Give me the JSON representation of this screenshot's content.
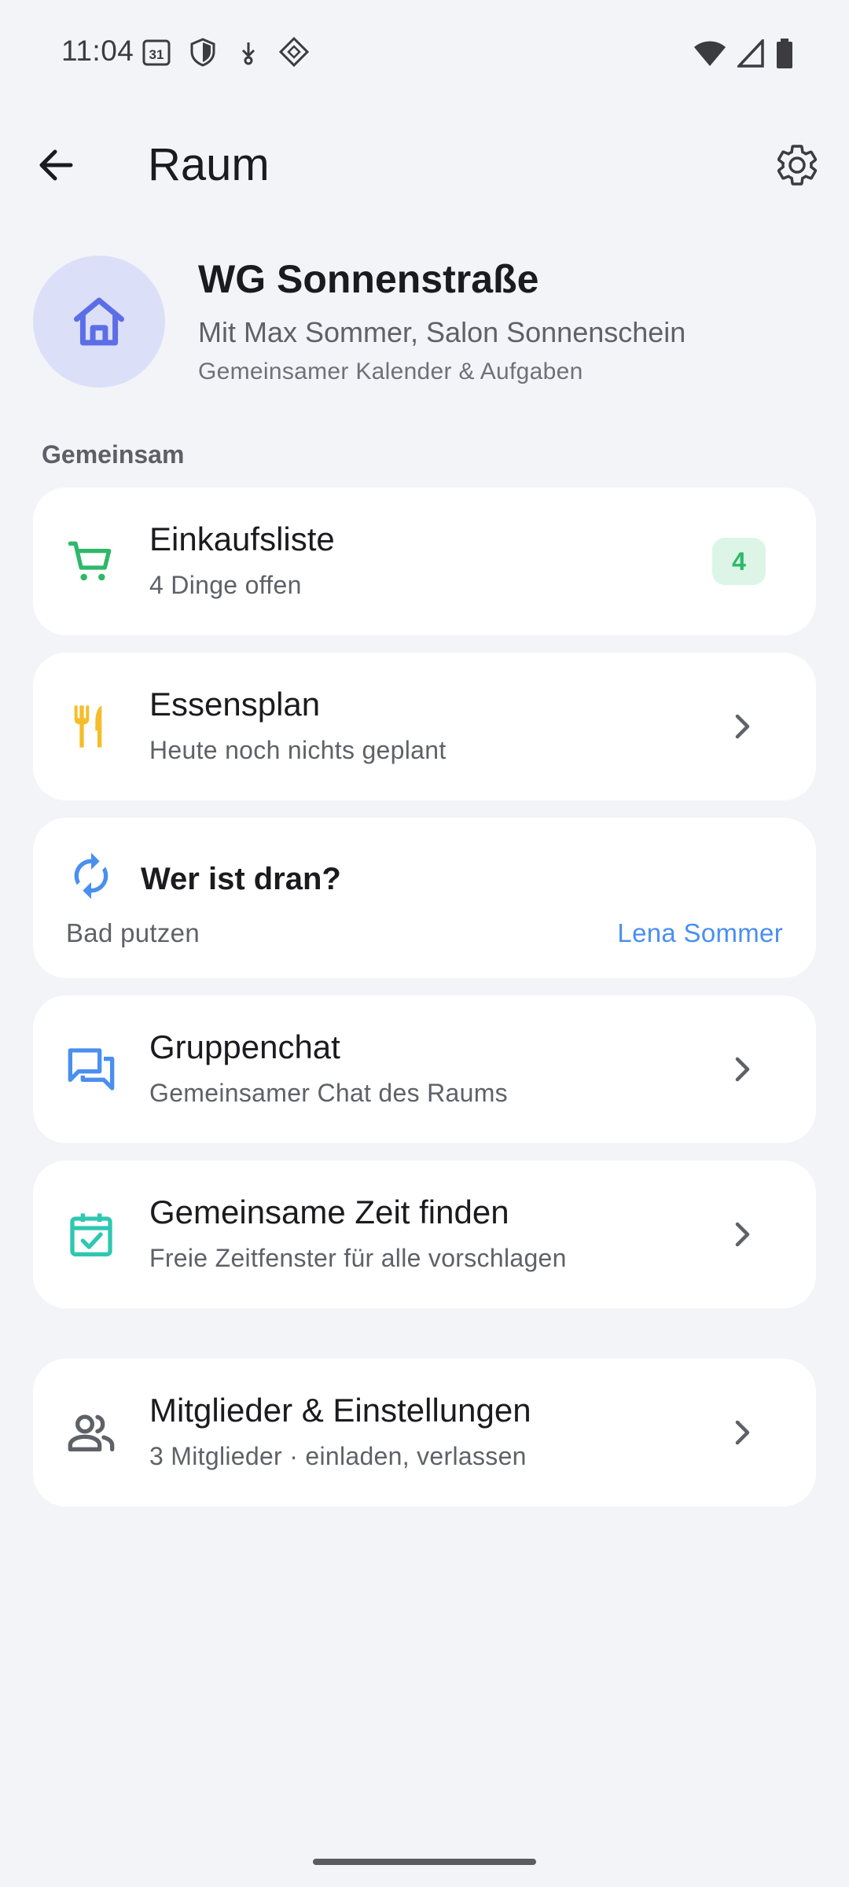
{
  "status_bar": {
    "time": "11:04",
    "calendar_day": "31",
    "icons_left": [
      "calendar-icon",
      "shield-icon",
      "download-icon",
      "vpn-icon"
    ],
    "icons_right": [
      "wifi-icon",
      "cell-signal-icon",
      "battery-icon"
    ]
  },
  "app_bar": {
    "title": "Raum",
    "back_icon": "arrow-left-icon",
    "settings_icon": "gear-icon"
  },
  "room": {
    "name": "WG Sonnenstraße",
    "members_line": "Mit Max Sommer, Salon Sonnenschein",
    "description": "Gemeinsamer Kalender & Aufgaben",
    "avatar_icon": "home-icon"
  },
  "section": {
    "label": "Gemeinsam"
  },
  "cards": {
    "shopping": {
      "title": "Einkaufsliste",
      "subtitle": "4 Dinge offen",
      "badge": "4",
      "icon": "cart-icon",
      "color": "#2fb869"
    },
    "meals": {
      "title": "Essensplan",
      "subtitle": "Heute noch nichts geplant",
      "icon": "utensils-icon",
      "color": "#f5bd2c"
    },
    "turn": {
      "title": "Wer ist dran?",
      "task": "Bad putzen",
      "person": "Lena Sommer",
      "icon": "refresh-icon",
      "color": "#4a8ff0"
    },
    "chat": {
      "title": "Gruppenchat",
      "subtitle": "Gemeinsamer Chat des Raums",
      "icon": "chat-icon",
      "color": "#4a8ff0"
    },
    "time": {
      "title": "Gemeinsame Zeit finden",
      "subtitle": "Freie Zeitfenster für alle vorschlagen",
      "icon": "calendar-check-icon",
      "color": "#2ec7b0"
    },
    "members": {
      "title": "Mitglieder & Einstellungen",
      "subtitle": "3 Mitglieder · einladen, verlassen",
      "icon": "people-icon",
      "color": "#5f6168"
    }
  },
  "colors": {
    "background": "#f3f4f8",
    "card": "#ffffff",
    "accent_blue": "#4a8ff0",
    "avatar_bg": "#dcdff8",
    "avatar_icon": "#5b6ee6"
  }
}
